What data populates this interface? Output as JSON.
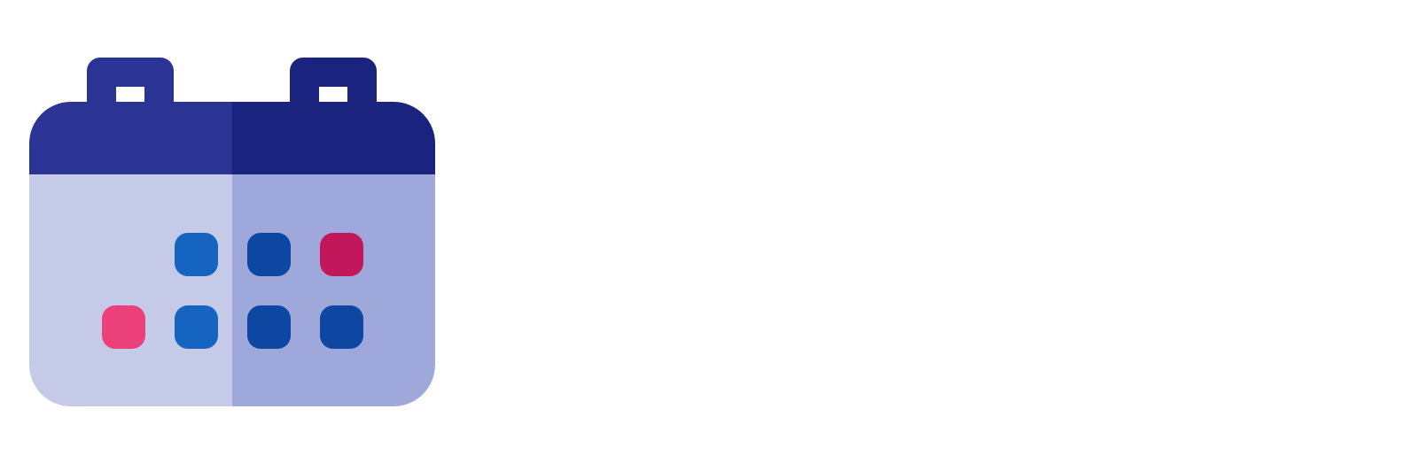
{
  "icon": {
    "name": "calendar-icon",
    "colors": {
      "header_left": "#2B3494",
      "header_right": "#1A237E",
      "body_left": "#C5CAE9",
      "body_right": "#9FA8DA",
      "ring_window": "#FFFFFF",
      "date_blue": "#1565C0",
      "date_navy": "#0D47A1",
      "date_magenta": "#C2185B",
      "date_pink": "#EC407A"
    },
    "date_cells": [
      {
        "row": 1,
        "col": 2,
        "color": "date_blue"
      },
      {
        "row": 1,
        "col": 3,
        "color": "date_navy"
      },
      {
        "row": 1,
        "col": 4,
        "color": "date_magenta"
      },
      {
        "row": 2,
        "col": 1,
        "color": "date_pink"
      },
      {
        "row": 2,
        "col": 2,
        "color": "date_blue"
      },
      {
        "row": 2,
        "col": 3,
        "color": "date_navy"
      },
      {
        "row": 2,
        "col": 4,
        "color": "date_navy"
      }
    ]
  }
}
